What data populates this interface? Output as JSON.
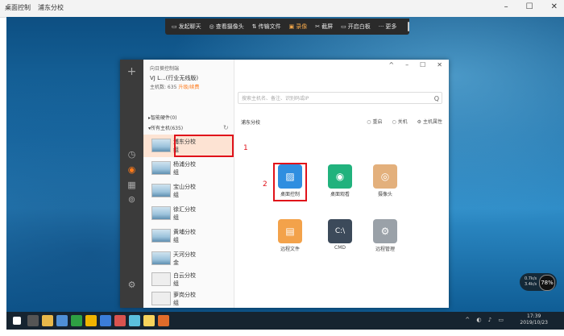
{
  "outer": {
    "tabs": [
      "桌面控制",
      "浦东分校"
    ],
    "min": "–",
    "max": "☐",
    "close": "✕"
  },
  "toolbar": {
    "items": [
      {
        "icon": "chat-icon",
        "glyph": "▭",
        "label": "发起聊天"
      },
      {
        "icon": "camera-icon",
        "glyph": "◎",
        "label": "查看摄像头"
      },
      {
        "icon": "transfer-icon",
        "glyph": "⇅",
        "label": "传输文件"
      },
      {
        "icon": "record-icon",
        "glyph": "▣",
        "label": "录像"
      },
      {
        "icon": "screenshot-icon",
        "glyph": "✂",
        "label": "截屏"
      },
      {
        "icon": "whiteboard-icon",
        "glyph": "▭",
        "label": "开启白板"
      },
      {
        "icon": "more-icon",
        "glyph": "···",
        "label": "更多"
      }
    ],
    "active_index": 3,
    "active_color": "#f0a64a"
  },
  "app": {
    "header": "向日葵控制端",
    "account_name": "VJ            L...(行业无线版)",
    "account_id": "主机数: 635",
    "account_link": "升级/续费",
    "win_min": "–",
    "win_restore": "☐",
    "win_close": "✕",
    "win_arrow": "^",
    "group_smart": "▸智能硬件(0)",
    "group_all": "▾所有主机(635)",
    "refresh": "↻",
    "hosts": [
      {
        "name": "浦东分校\n组"
      },
      {
        "name": "杨浦分校\n组"
      },
      {
        "name": "宝山分校\n组"
      },
      {
        "name": "徐汇分校\n组"
      },
      {
        "name": "黄埔分校\n组"
      },
      {
        "name": "天河分校\n金"
      },
      {
        "name": "白云分校\n组"
      },
      {
        "name": "萝岗分校\n组"
      }
    ],
    "selected_index": 0,
    "marker1": "1",
    "marker2": "2",
    "search_placeholder": "搜索主机名、备注、识别码或IP",
    "search_icon": "Q",
    "group_title": "浦东分校",
    "actions": [
      {
        "icon": "restart-icon",
        "glyph": "○",
        "label": "重启"
      },
      {
        "icon": "shutdown-icon",
        "glyph": "○",
        "label": "关机"
      },
      {
        "icon": "settings-icon",
        "glyph": "⚙",
        "label": "主机属性"
      }
    ],
    "tiles": [
      {
        "icon": "desktop-control-icon",
        "label": "桌面控制",
        "color": "#2f8ee0"
      },
      {
        "icon": "desktop-view-icon",
        "label": "桌面观看",
        "color": "#21b27d"
      },
      {
        "icon": "webcam-icon",
        "label": "摄像头",
        "color": "#e3b07c"
      },
      {
        "icon": "remote-file-icon",
        "label": "远程文件",
        "color": "#f3a24a"
      },
      {
        "icon": "cmd-icon",
        "label": "CMD",
        "color": "#3c4a5a"
      },
      {
        "icon": "remote-manage-icon",
        "label": "远程管理",
        "color": "#9aa1a8"
      }
    ]
  },
  "taskbar": {
    "time": "17:39",
    "date": "2019/10/23"
  },
  "widget": {
    "value": "78",
    "unit": "%",
    "up": "0.7k/s",
    "down": "3.4k/s"
  }
}
